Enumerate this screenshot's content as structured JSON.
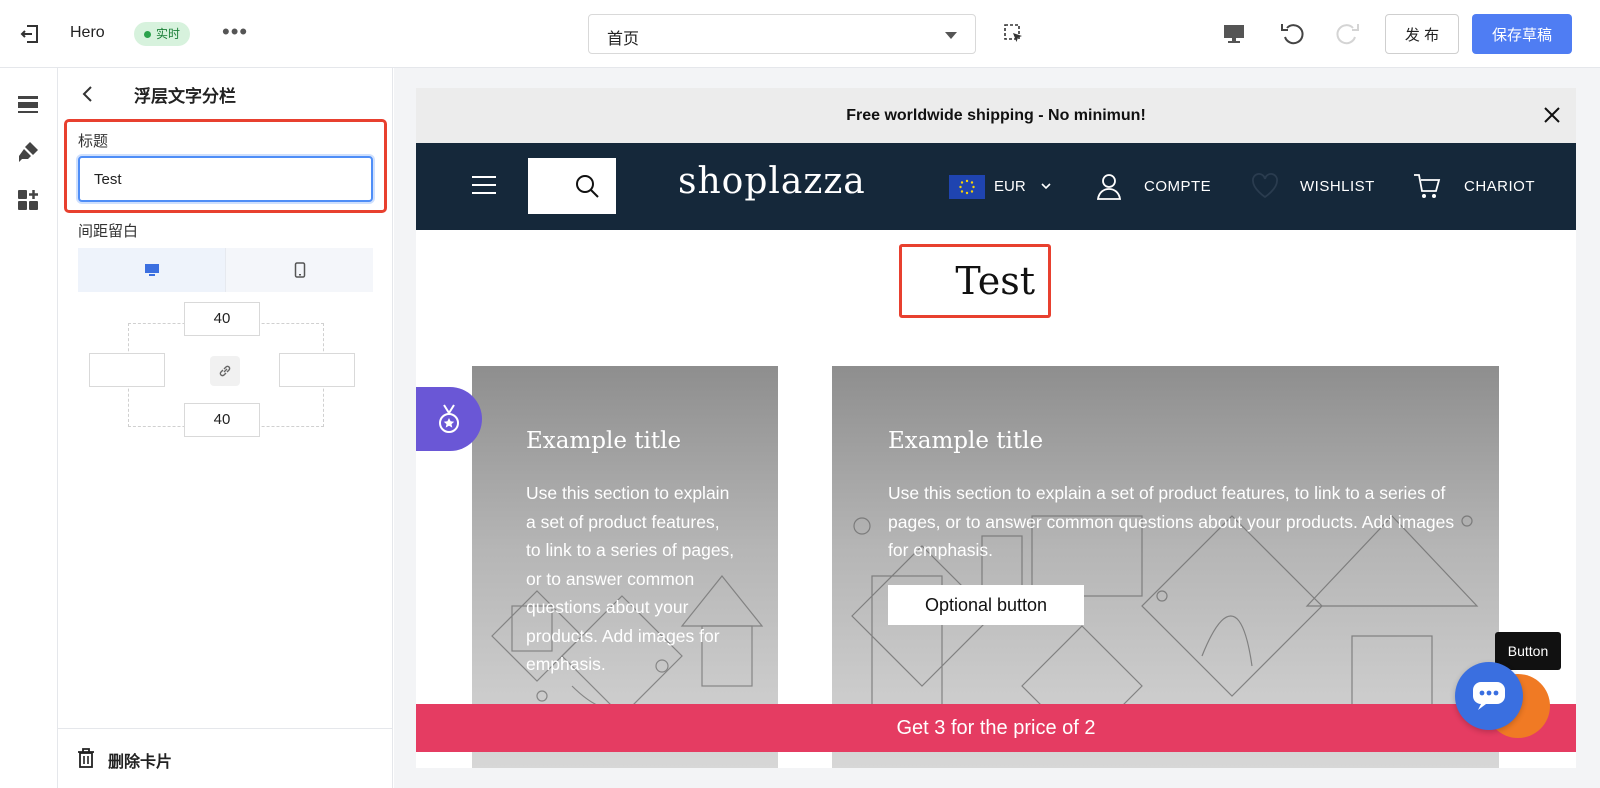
{
  "topbar": {
    "app_title": "Hero",
    "live_badge": "实时",
    "more": "•••",
    "page_select_value": "首页",
    "publish_label": "发 布",
    "save_label": "保存草稿"
  },
  "panel": {
    "title": "浮层文字分栏",
    "title_field_label": "标题",
    "title_field_value": "Test",
    "spacing_label": "间距留白",
    "padding_top": "40",
    "padding_bottom": "40",
    "padding_left": "",
    "padding_right": "",
    "delete_label": "删除卡片"
  },
  "preview": {
    "announcement": "Free worldwide shipping - No minimun!",
    "logo": "shoplazza",
    "currency": "EUR",
    "account_label": "COMPTE",
    "wishlist_label": "WISHLIST",
    "cart_label": "CHARIOT",
    "heading": "Test",
    "cards": [
      {
        "title": "Example title",
        "text": "Use this section to explain a set of product features, to link to a series of pages, or to answer common questions about your products. Add images for emphasis."
      },
      {
        "title": "Example title",
        "text": "Use this section to explain a set of product features, to link to a series of pages, or to answer common questions about your products. Add images for emphasis.",
        "button": "Optional button"
      }
    ],
    "promo": "Get 3 for the price of 2",
    "tooltip": "Button"
  },
  "colors": {
    "accent": "#4f7df3",
    "highlight": "#e8402f",
    "header_bg": "#15283a",
    "promo_bg": "#e53c62",
    "badge": "#6a57d6"
  }
}
